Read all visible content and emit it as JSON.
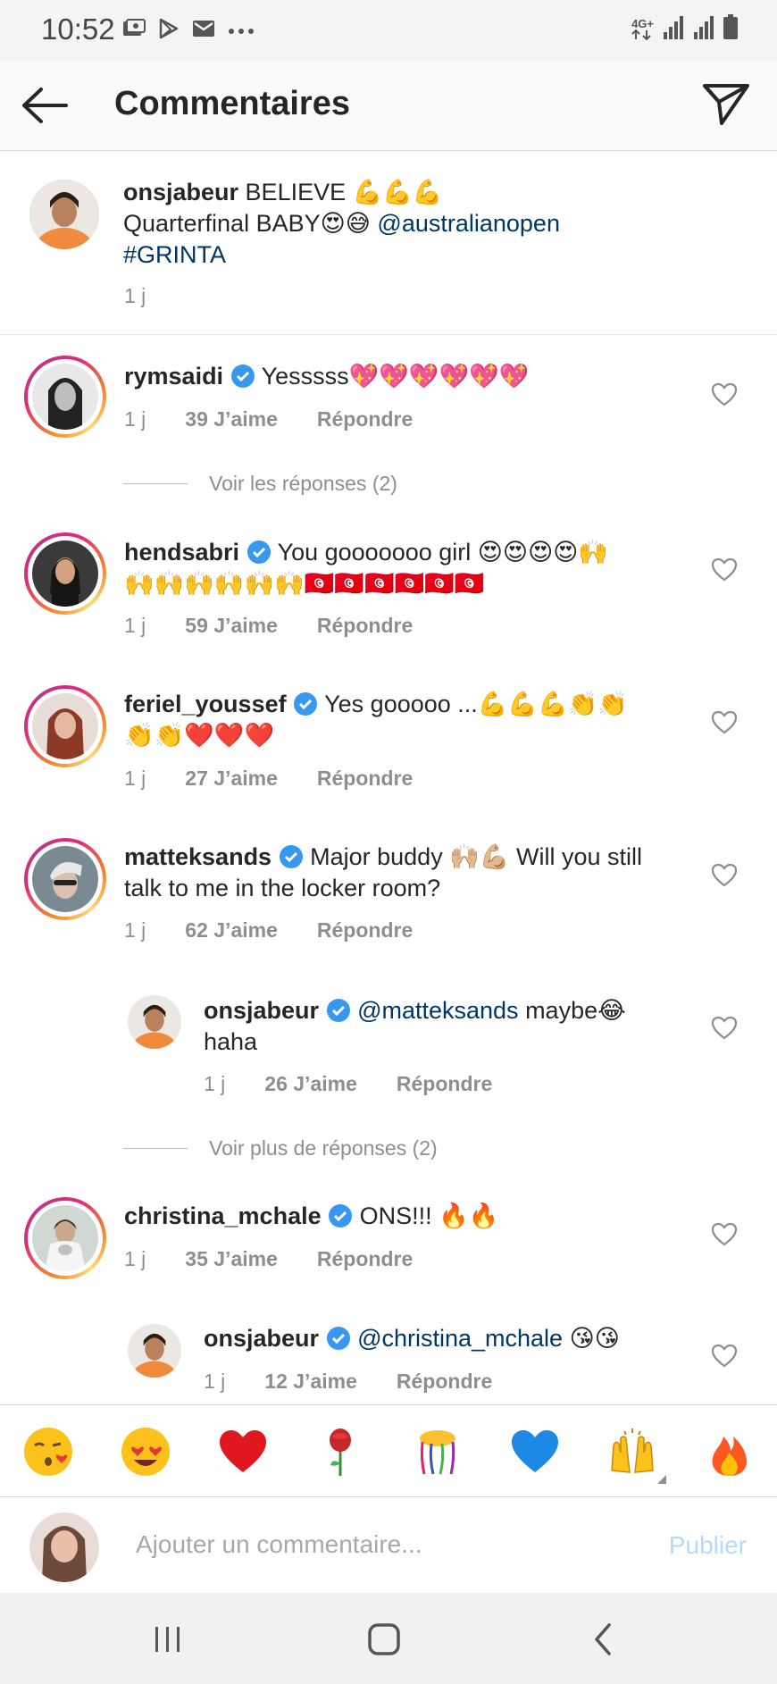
{
  "status_bar": {
    "time": "10:52",
    "network": "4G+",
    "icons_left": [
      "photo-notification-icon",
      "play-store-icon",
      "gmail-icon",
      "more-dots-icon"
    ],
    "icons_right": [
      "4g-plus-icon",
      "signal-icon",
      "signal-icon",
      "battery-icon"
    ]
  },
  "header": {
    "title": "Commentaires",
    "back_icon": "arrow-left-icon",
    "send_icon": "paper-plane-icon"
  },
  "caption": {
    "username": "onsjabeur",
    "text_line1": "BELIEVE",
    "line1_emoji": "💪💪💪",
    "text_line2": "Quarterfinal BABY",
    "line2_emoji": "😍😅",
    "mention": "@australianopen",
    "hashtag": "#GRINTA",
    "time": "1 j"
  },
  "comments": [
    {
      "username": "rymsaidi",
      "verified": true,
      "text": "Yesssss",
      "emoji": "💖💖💖💖💖💖",
      "time": "1 j",
      "likes": "39 J’aime",
      "reply": "Répondre",
      "view_replies": "Voir les réponses (2)"
    },
    {
      "username": "hendsabri",
      "verified": true,
      "text": "You gooooooo girl",
      "emoji": "😍😍😍😍🙌",
      "emoji_line2": "🙌🙌🙌🙌🙌🙌🇹🇳🇹🇳🇹🇳🇹🇳🇹🇳🇹🇳",
      "time": "1 j",
      "likes": "59 J’aime",
      "reply": "Répondre"
    },
    {
      "username": "feriel_youssef",
      "verified": true,
      "text": "Yes gooooo ...",
      "emoji": "💪💪💪👏👏",
      "emoji_line2": "👏👏❤️❤️❤️",
      "time": "1 j",
      "likes": "27 J’aime",
      "reply": "Répondre"
    },
    {
      "username": "matteksands",
      "verified": true,
      "text": "Major buddy",
      "emoji": "🙌🏼💪🏼",
      "text_after": "Will you still",
      "text_line2": "talk to me in the locker room?",
      "time": "1 j",
      "likes": "62 J’aime",
      "reply": "Répondre",
      "reply_item": {
        "username": "onsjabeur",
        "verified": true,
        "mention": "@matteksands",
        "text": "maybe",
        "emoji": "😂",
        "text_line2": "haha",
        "time": "1 j",
        "likes": "26 J’aime",
        "reply": "Répondre"
      },
      "view_more": "Voir plus de réponses (2)"
    },
    {
      "username": "christina_mchale",
      "verified": true,
      "text": "ONS!!!",
      "emoji": "🔥🔥",
      "time": "1 j",
      "likes": "35 J’aime",
      "reply": "Répondre",
      "reply_item": {
        "username": "onsjabeur",
        "verified": true,
        "mention": "@christina_mchale",
        "emoji": "😘😘",
        "time": "1 j",
        "likes": "12 J’aime",
        "reply": "Répondre"
      }
    }
  ],
  "emoji_bar": [
    "😘",
    "😍",
    "❤️",
    "🌹",
    "🎊",
    "💙",
    "🙌",
    "🔥"
  ],
  "composer": {
    "placeholder": "Ajouter un commentaire...",
    "publish": "Publier"
  },
  "colors": {
    "text": "#262626",
    "secondary": "#8e8e8e",
    "link": "#003569",
    "verified": "#3897f0",
    "publish_disabled": "#b3dbff"
  },
  "nav_icons": [
    "recent-apps-icon",
    "home-icon",
    "back-icon"
  ]
}
